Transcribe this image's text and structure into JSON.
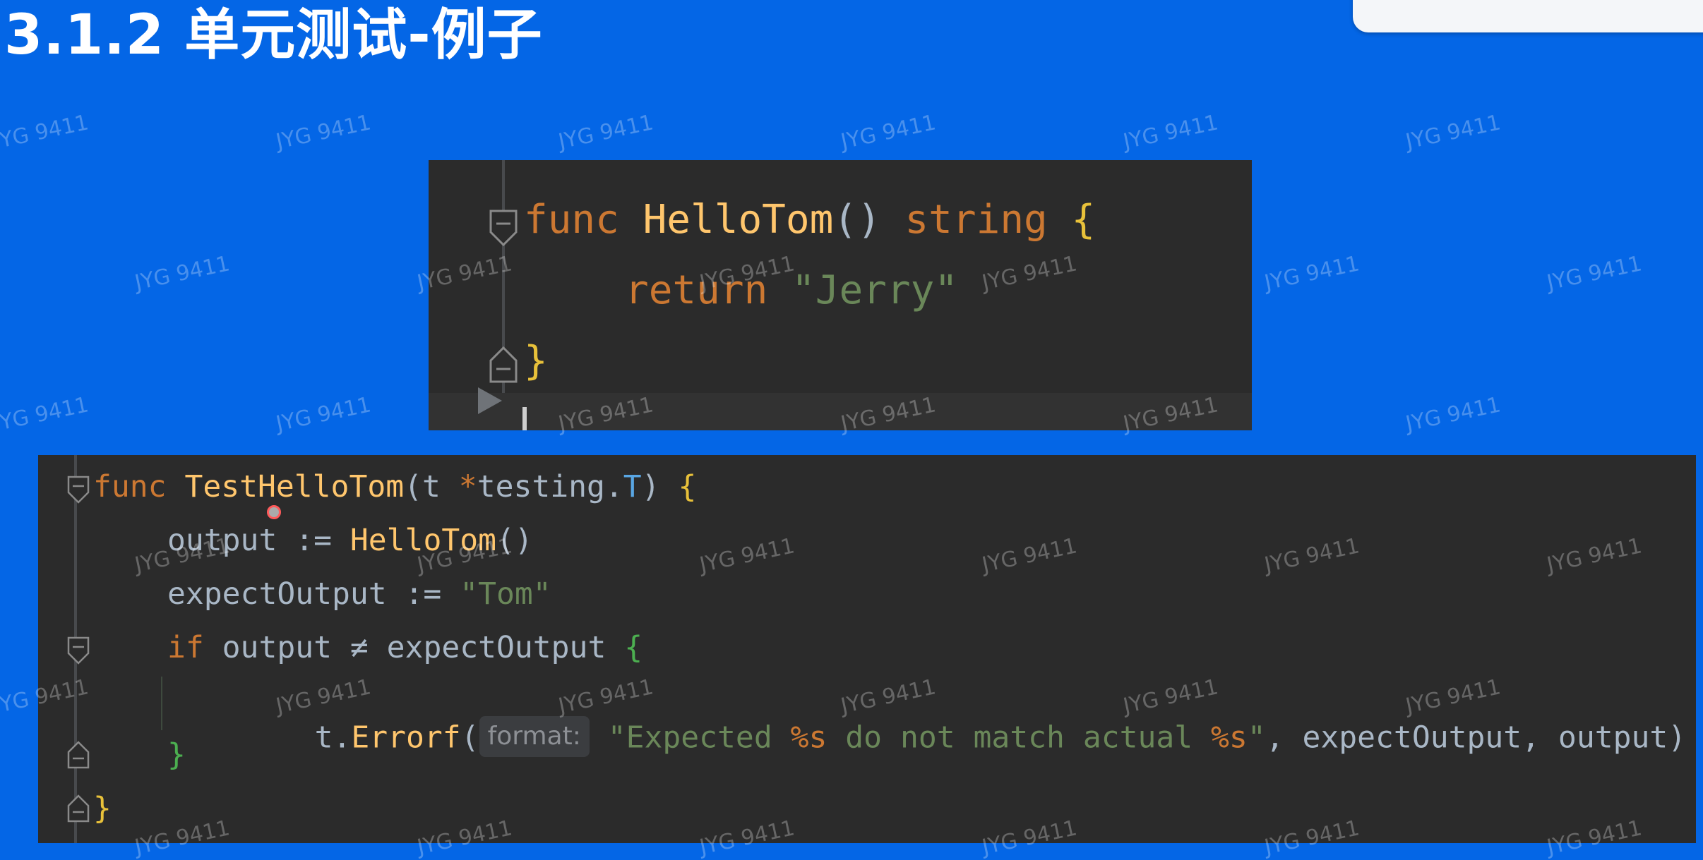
{
  "slide": {
    "title": "3.1.2 单元测试-例子"
  },
  "watermark": "JYG 9411",
  "top_code": {
    "lines": [
      [
        {
          "t": "func ",
          "c": "kw"
        },
        {
          "t": "HelloTom",
          "c": "fn"
        },
        {
          "t": "() ",
          "c": "id"
        },
        {
          "t": "string ",
          "c": "kw"
        },
        {
          "t": "{",
          "c": "brace"
        }
      ],
      [
        {
          "t": "return ",
          "c": "kw"
        },
        {
          "t": "\"Jerry\"",
          "c": "str"
        }
      ],
      [
        {
          "t": "}",
          "c": "brace"
        }
      ]
    ]
  },
  "bottom_code": {
    "line1": [
      {
        "t": "func ",
        "c": "kw"
      },
      {
        "t": "TestHelloTom",
        "c": "fn"
      },
      {
        "t": "(t ",
        "c": "id"
      },
      {
        "t": "*",
        "c": "kw"
      },
      {
        "t": "testing",
        "c": "pkg"
      },
      {
        "t": ".",
        "c": "id"
      },
      {
        "t": "T",
        "c": "typ"
      },
      {
        "t": ") ",
        "c": "id"
      },
      {
        "t": "{",
        "c": "brace"
      }
    ],
    "line2": [
      {
        "t": "output ",
        "c": "id"
      },
      {
        "t": ":= ",
        "c": "id"
      },
      {
        "t": "HelloTom",
        "c": "fn"
      },
      {
        "t": "()",
        "c": "id"
      }
    ],
    "line3": [
      {
        "t": "expectOutput ",
        "c": "id"
      },
      {
        "t": ":= ",
        "c": "id"
      },
      {
        "t": "\"Tom\"",
        "c": "str"
      }
    ],
    "line4": [
      {
        "t": "if ",
        "c": "kw"
      },
      {
        "t": "output ",
        "c": "id"
      },
      {
        "t": "≠ ",
        "c": "id"
      },
      {
        "t": "expectOutput ",
        "c": "id"
      },
      {
        "t": "{",
        "c": "brace-g"
      }
    ],
    "line5_prefix": [
      {
        "t": "t",
        "c": "id"
      },
      {
        "t": ".",
        "c": "id"
      },
      {
        "t": "Errorf",
        "c": "fn"
      },
      {
        "t": "(",
        "c": "id"
      }
    ],
    "line5_hint": "format:",
    "line5_suffix": [
      {
        "t": " ",
        "c": "id"
      },
      {
        "t": "\"Expected ",
        "c": "str"
      },
      {
        "t": "%s",
        "c": "fmt"
      },
      {
        "t": " do not match actual ",
        "c": "str"
      },
      {
        "t": "%s",
        "c": "fmt"
      },
      {
        "t": "\"",
        "c": "str"
      },
      {
        "t": ", expectOutput, output)",
        "c": "id"
      }
    ],
    "line6": [
      {
        "t": "}",
        "c": "brace-g"
      }
    ],
    "line7": [
      {
        "t": "}",
        "c": "brace"
      }
    ]
  }
}
